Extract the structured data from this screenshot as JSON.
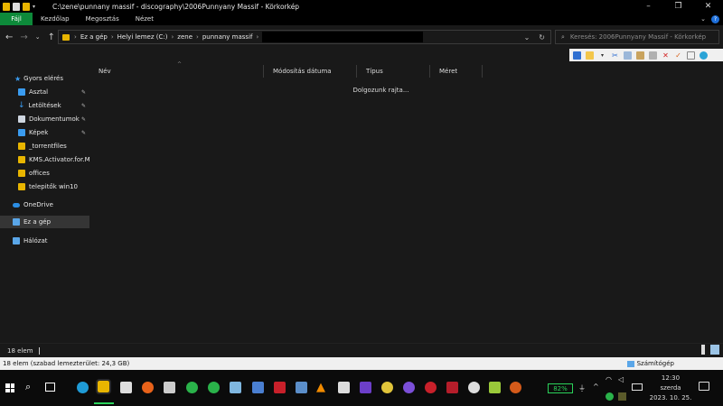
{
  "window": {
    "title": "C:\\zene\\punnany massif - discography\\2006Punnyany Massif - Körkorkép"
  },
  "ribbon": {
    "tabs": [
      "Fájl",
      "Kezdőlap",
      "Megosztás",
      "Nézet"
    ]
  },
  "address": {
    "crumbs": [
      "Ez a gép",
      "Helyi lemez (C:)",
      "zene",
      "punnany massif"
    ],
    "search_placeholder": "Keresés: 2006Punnyany Massif - Körkorkép"
  },
  "sidebar": {
    "items": [
      {
        "label": "Gyors elérés",
        "icon": "star-icon",
        "color": "#3a9cf0",
        "pinned": false
      },
      {
        "label": "Asztal",
        "icon": "desktop-icon",
        "color": "#3a9cf0",
        "pinned": true
      },
      {
        "label": "Letöltések",
        "icon": "download-icon",
        "color": "#3a9cf0",
        "pinned": true
      },
      {
        "label": "Dokumentumok",
        "icon": "document-icon",
        "color": "#cfd6e0",
        "pinned": true
      },
      {
        "label": "Képek",
        "icon": "pictures-icon",
        "color": "#3a9cf0",
        "pinned": true
      },
      {
        "label": "_torrentfiles",
        "icon": "folder-icon",
        "color": "#e8b500",
        "pinned": false
      },
      {
        "label": "KMS.Activator.for.M",
        "icon": "folder-icon",
        "color": "#e8b500",
        "pinned": false
      },
      {
        "label": "offices",
        "icon": "folder-icon",
        "color": "#e8b500",
        "pinned": false
      },
      {
        "label": "telepitők win10",
        "icon": "folder-icon",
        "color": "#e8b500",
        "pinned": false
      },
      {
        "label": "OneDrive",
        "icon": "cloud-icon",
        "color": "#2b8de3",
        "pinned": false
      },
      {
        "label": "Ez a gép",
        "icon": "computer-icon",
        "color": "#5aa6e8",
        "pinned": false
      },
      {
        "label": "Hálózat",
        "icon": "network-icon",
        "color": "#5aa6e8",
        "pinned": false
      }
    ]
  },
  "columns": [
    "Név",
    "Módosítás dátuma",
    "Típus",
    "Méret"
  ],
  "main": {
    "working_text": "Dolgozunk rajta..."
  },
  "status": {
    "item_count": "18 elem",
    "detail": "18 elem (szabad lemezterület: 24,3 GB)",
    "zone": "Számítógép"
  },
  "tray": {
    "battery": "82%",
    "time": "12:30",
    "day": "szerda",
    "date": "2023. 10. 25."
  }
}
